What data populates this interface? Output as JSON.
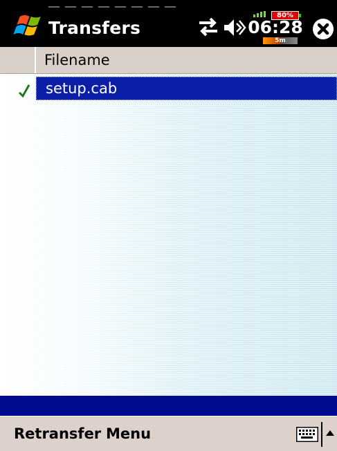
{
  "title_bar": {
    "title": "Transfers",
    "clock": "06:28",
    "battery_percent": "80%",
    "timer_badge": "5m",
    "icons": [
      "windows-start-icon",
      "connectivity-icon",
      "speaker-icon",
      "signal-icon",
      "close-icon"
    ]
  },
  "list": {
    "header_filename": "Filename",
    "rows": [
      {
        "filename": "setup.cab",
        "status": "check-icon",
        "selected": true
      }
    ]
  },
  "command_bar": {
    "left_label": "Retransfer",
    "right_label": "Menu",
    "icons": [
      "keyboard-icon",
      "sip-arrow-up-icon"
    ]
  },
  "colors": {
    "title_bar_bg": "#000000",
    "selection": "#0a1ea8",
    "header_bg": "#d8d0c8",
    "command_bar_bg": "#dcd2cb",
    "status_strip": "#000a90"
  }
}
